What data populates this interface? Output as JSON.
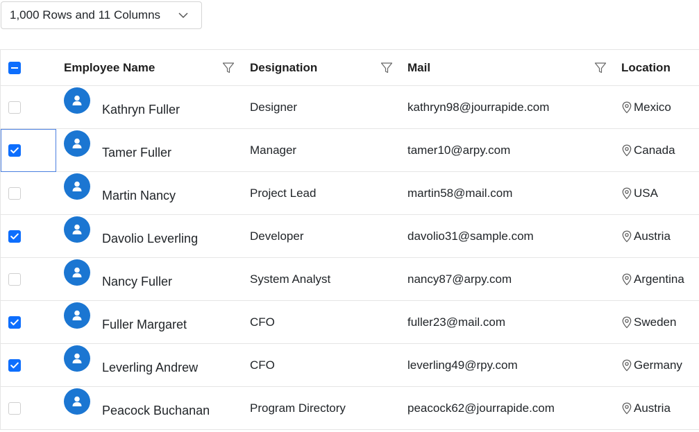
{
  "dropdown": {
    "value": "1,000 Rows and 11 Columns"
  },
  "columns": {
    "employee_name": "Employee Name",
    "designation": "Designation",
    "mail": "Mail",
    "location": "Location"
  },
  "rows": [
    {
      "checked": false,
      "name": "Kathryn Fuller",
      "designation": "Designer",
      "mail": "kathryn98@jourrapide.com",
      "location": "Mexico"
    },
    {
      "checked": true,
      "name": "Tamer Fuller",
      "designation": "Manager",
      "mail": "tamer10@arpy.com",
      "location": "Canada"
    },
    {
      "checked": false,
      "name": "Martin Nancy",
      "designation": "Project Lead",
      "mail": "martin58@mail.com",
      "location": "USA"
    },
    {
      "checked": true,
      "name": "Davolio Leverling",
      "designation": "Developer",
      "mail": "davolio31@sample.com",
      "location": "Austria"
    },
    {
      "checked": false,
      "name": "Nancy Fuller",
      "designation": "System Analyst",
      "mail": "nancy87@arpy.com",
      "location": "Argentina"
    },
    {
      "checked": true,
      "name": "Fuller Margaret",
      "designation": "CFO",
      "mail": "fuller23@mail.com",
      "location": "Sweden"
    },
    {
      "checked": true,
      "name": "Leverling Andrew",
      "designation": "CFO",
      "mail": "leverling49@rpy.com",
      "location": "Germany"
    },
    {
      "checked": false,
      "name": "Peacock Buchanan",
      "designation": "Program Directory",
      "mail": "peacock62@jourrapide.com",
      "location": "Austria"
    }
  ],
  "colors": {
    "accent": "#0d6efd",
    "avatar": "#1b76d2",
    "border": "#e5e5e5"
  },
  "icons": {
    "filter": "filter-icon",
    "avatar": "user-avatar-icon",
    "location": "map-pin-icon",
    "dropdown": "chevron-down-icon"
  }
}
